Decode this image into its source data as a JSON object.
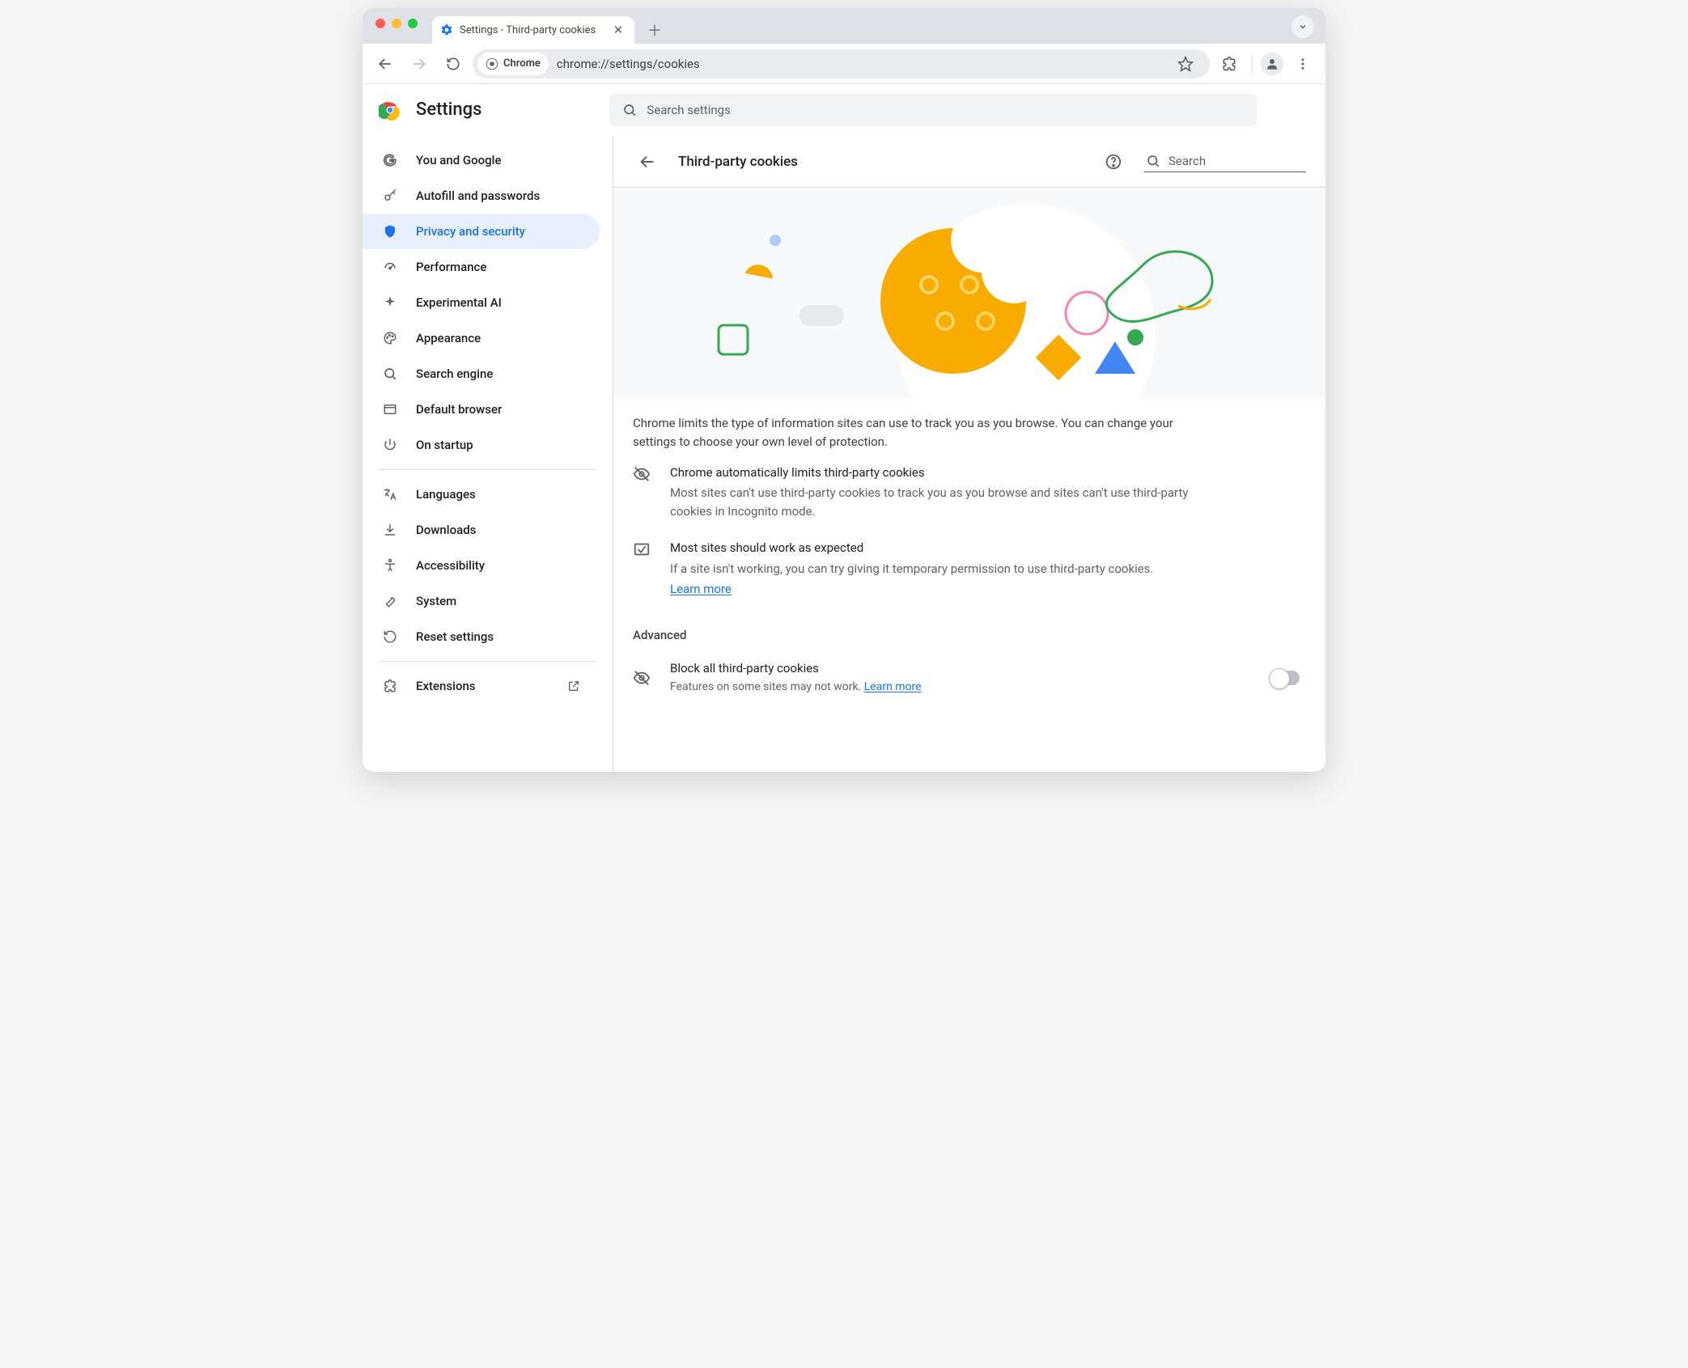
{
  "browser": {
    "tab_title": "Settings - Third-party cookies",
    "omnibox_chip": "Chrome",
    "url": "chrome://settings/cookies"
  },
  "app": {
    "title": "Settings",
    "search_placeholder": "Search settings"
  },
  "sidebar": {
    "items": [
      {
        "id": "you-and-google",
        "label": "You and Google"
      },
      {
        "id": "autofill",
        "label": "Autofill and passwords"
      },
      {
        "id": "privacy",
        "label": "Privacy and security"
      },
      {
        "id": "performance",
        "label": "Performance"
      },
      {
        "id": "experimental-ai",
        "label": "Experimental AI"
      },
      {
        "id": "appearance",
        "label": "Appearance"
      },
      {
        "id": "search-engine",
        "label": "Search engine"
      },
      {
        "id": "default-browser",
        "label": "Default browser"
      },
      {
        "id": "on-startup",
        "label": "On startup"
      }
    ],
    "items2": [
      {
        "id": "languages",
        "label": "Languages"
      },
      {
        "id": "downloads",
        "label": "Downloads"
      },
      {
        "id": "accessibility",
        "label": "Accessibility"
      },
      {
        "id": "system",
        "label": "System"
      },
      {
        "id": "reset",
        "label": "Reset settings"
      }
    ],
    "items3": [
      {
        "id": "extensions",
        "label": "Extensions"
      }
    ]
  },
  "content": {
    "title": "Third-party cookies",
    "search_placeholder": "Search",
    "intro": "Chrome limits the type of information sites can use to track you as you browse. You can change your settings to choose your own level of protection.",
    "rows": [
      {
        "title": "Chrome automatically limits third-party cookies",
        "desc": "Most sites can't use third-party cookies to track you as you browse and sites can't use third-party cookies in Incognito mode."
      },
      {
        "title": "Most sites should work as expected",
        "desc": "If a site isn't working, you can try giving it temporary permission to use third-party cookies.",
        "link": "Learn more"
      }
    ],
    "advanced_label": "Advanced",
    "block_row": {
      "title": "Block all third-party cookies",
      "desc_prefix": "Features on some sites may not work. ",
      "link": "Learn more"
    }
  }
}
